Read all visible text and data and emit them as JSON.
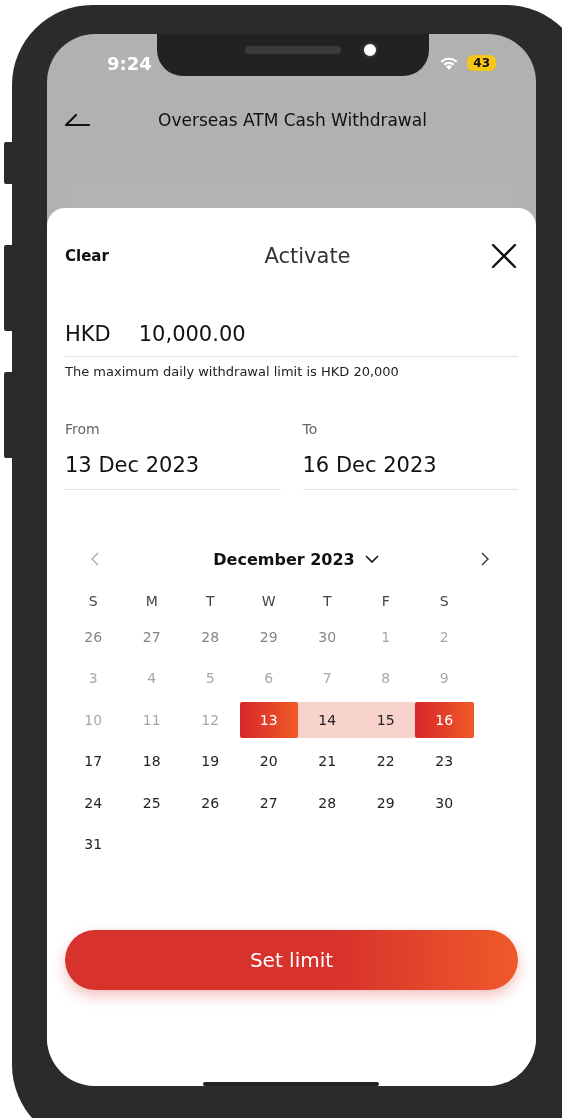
{
  "status_bar": {
    "time": "9:24",
    "battery": "43"
  },
  "header": {
    "title": "Overseas ATM Cash Withdrawal"
  },
  "sheet": {
    "clear": "Clear",
    "title": "Activate",
    "amount": {
      "currency": "HKD",
      "value": "10,000.00"
    },
    "note": "The maximum daily withdrawal limit is HKD 20,000",
    "from": {
      "label": "From",
      "value": "13 Dec 2023"
    },
    "to": {
      "label": "To",
      "value": "16 Dec 2023"
    },
    "calendar": {
      "month": "December 2023",
      "weekdays": [
        "S",
        "M",
        "T",
        "W",
        "T",
        "F",
        "S"
      ],
      "weeks": [
        [
          {
            "day": "26",
            "other_month": true,
            "disabled": false,
            "selected": false,
            "in_range": false
          },
          {
            "day": "27",
            "other_month": true,
            "disabled": false,
            "selected": false,
            "in_range": false
          },
          {
            "day": "28",
            "other_month": true,
            "disabled": false,
            "selected": false,
            "in_range": false
          },
          {
            "day": "29",
            "other_month": true,
            "disabled": false,
            "selected": false,
            "in_range": false
          },
          {
            "day": "30",
            "other_month": true,
            "disabled": false,
            "selected": false,
            "in_range": false
          },
          {
            "day": "1",
            "other_month": false,
            "disabled": true,
            "selected": false,
            "in_range": false
          },
          {
            "day": "2",
            "other_month": false,
            "disabled": true,
            "selected": false,
            "in_range": false
          }
        ],
        [
          {
            "day": "3",
            "other_month": false,
            "disabled": true,
            "selected": false,
            "in_range": false
          },
          {
            "day": "4",
            "other_month": false,
            "disabled": true,
            "selected": false,
            "in_range": false
          },
          {
            "day": "5",
            "other_month": false,
            "disabled": true,
            "selected": false,
            "in_range": false
          },
          {
            "day": "6",
            "other_month": false,
            "disabled": true,
            "selected": false,
            "in_range": false
          },
          {
            "day": "7",
            "other_month": false,
            "disabled": true,
            "selected": false,
            "in_range": false
          },
          {
            "day": "8",
            "other_month": false,
            "disabled": true,
            "selected": false,
            "in_range": false
          },
          {
            "day": "9",
            "other_month": false,
            "disabled": true,
            "selected": false,
            "in_range": false
          }
        ],
        [
          {
            "day": "10",
            "other_month": false,
            "disabled": true,
            "selected": false,
            "in_range": false
          },
          {
            "day": "11",
            "other_month": false,
            "disabled": true,
            "selected": false,
            "in_range": false
          },
          {
            "day": "12",
            "other_month": false,
            "disabled": true,
            "selected": false,
            "in_range": false
          },
          {
            "day": "13",
            "other_month": false,
            "disabled": false,
            "selected": true,
            "in_range": false
          },
          {
            "day": "14",
            "other_month": false,
            "disabled": false,
            "selected": false,
            "in_range": true
          },
          {
            "day": "15",
            "other_month": false,
            "disabled": false,
            "selected": false,
            "in_range": true
          },
          {
            "day": "16",
            "other_month": false,
            "disabled": false,
            "selected": true,
            "in_range": false
          }
        ],
        [
          {
            "day": "17",
            "other_month": false,
            "disabled": false,
            "selected": false,
            "in_range": false
          },
          {
            "day": "18",
            "other_month": false,
            "disabled": false,
            "selected": false,
            "in_range": false
          },
          {
            "day": "19",
            "other_month": false,
            "disabled": false,
            "selected": false,
            "in_range": false
          },
          {
            "day": "20",
            "other_month": false,
            "disabled": false,
            "selected": false,
            "in_range": false
          },
          {
            "day": "21",
            "other_month": false,
            "disabled": false,
            "selected": false,
            "in_range": false
          },
          {
            "day": "22",
            "other_month": false,
            "disabled": false,
            "selected": false,
            "in_range": false
          },
          {
            "day": "23",
            "other_month": false,
            "disabled": false,
            "selected": false,
            "in_range": false
          }
        ],
        [
          {
            "day": "24",
            "other_month": false,
            "disabled": false,
            "selected": false,
            "in_range": false
          },
          {
            "day": "25",
            "other_month": false,
            "disabled": false,
            "selected": false,
            "in_range": false
          },
          {
            "day": "26",
            "other_month": false,
            "disabled": false,
            "selected": false,
            "in_range": false
          },
          {
            "day": "27",
            "other_month": false,
            "disabled": false,
            "selected": false,
            "in_range": false
          },
          {
            "day": "28",
            "other_month": false,
            "disabled": false,
            "selected": false,
            "in_range": false
          },
          {
            "day": "29",
            "other_month": false,
            "disabled": false,
            "selected": false,
            "in_range": false
          },
          {
            "day": "30",
            "other_month": false,
            "disabled": false,
            "selected": false,
            "in_range": false
          }
        ],
        [
          {
            "day": "31",
            "other_month": false,
            "disabled": false,
            "selected": false,
            "in_range": false
          }
        ]
      ]
    },
    "button": "Set limit"
  }
}
